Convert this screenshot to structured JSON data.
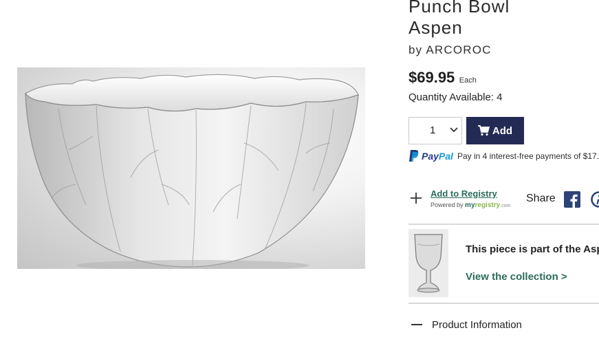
{
  "product": {
    "title_line1": "Punch Bowl",
    "title_line2": "Aspen",
    "byline": "by ARCOROC",
    "price": "$69.95",
    "price_unit": "Each",
    "quantity_available": "Quantity Available: 4",
    "image_icon": "glass-leaf-bowl-image"
  },
  "purchase": {
    "quantity_value": "1",
    "add_label": "Add",
    "paypal_brand_1": "Pay",
    "paypal_brand_2": "Pal",
    "paypal_text": "Pay in 4 interest-free payments of $17."
  },
  "registry": {
    "link_label": "Add to Registry",
    "powered_by": "Powered by",
    "brand_my": "my",
    "brand_registry": "registry",
    "brand_com": ".com"
  },
  "share": {
    "label": "Share",
    "icons": [
      "facebook-icon",
      "pinterest-icon"
    ]
  },
  "collection": {
    "text": "This piece is part of the Asp",
    "link": "View the collection >"
  },
  "product_information": {
    "label": "Product Information"
  },
  "colors": {
    "add_button": "#232b55",
    "link_green": "#2b6b5c",
    "paypal_blue": "#253b80",
    "paypal_light_blue": "#179bd7",
    "facebook": "#2d4477"
  }
}
